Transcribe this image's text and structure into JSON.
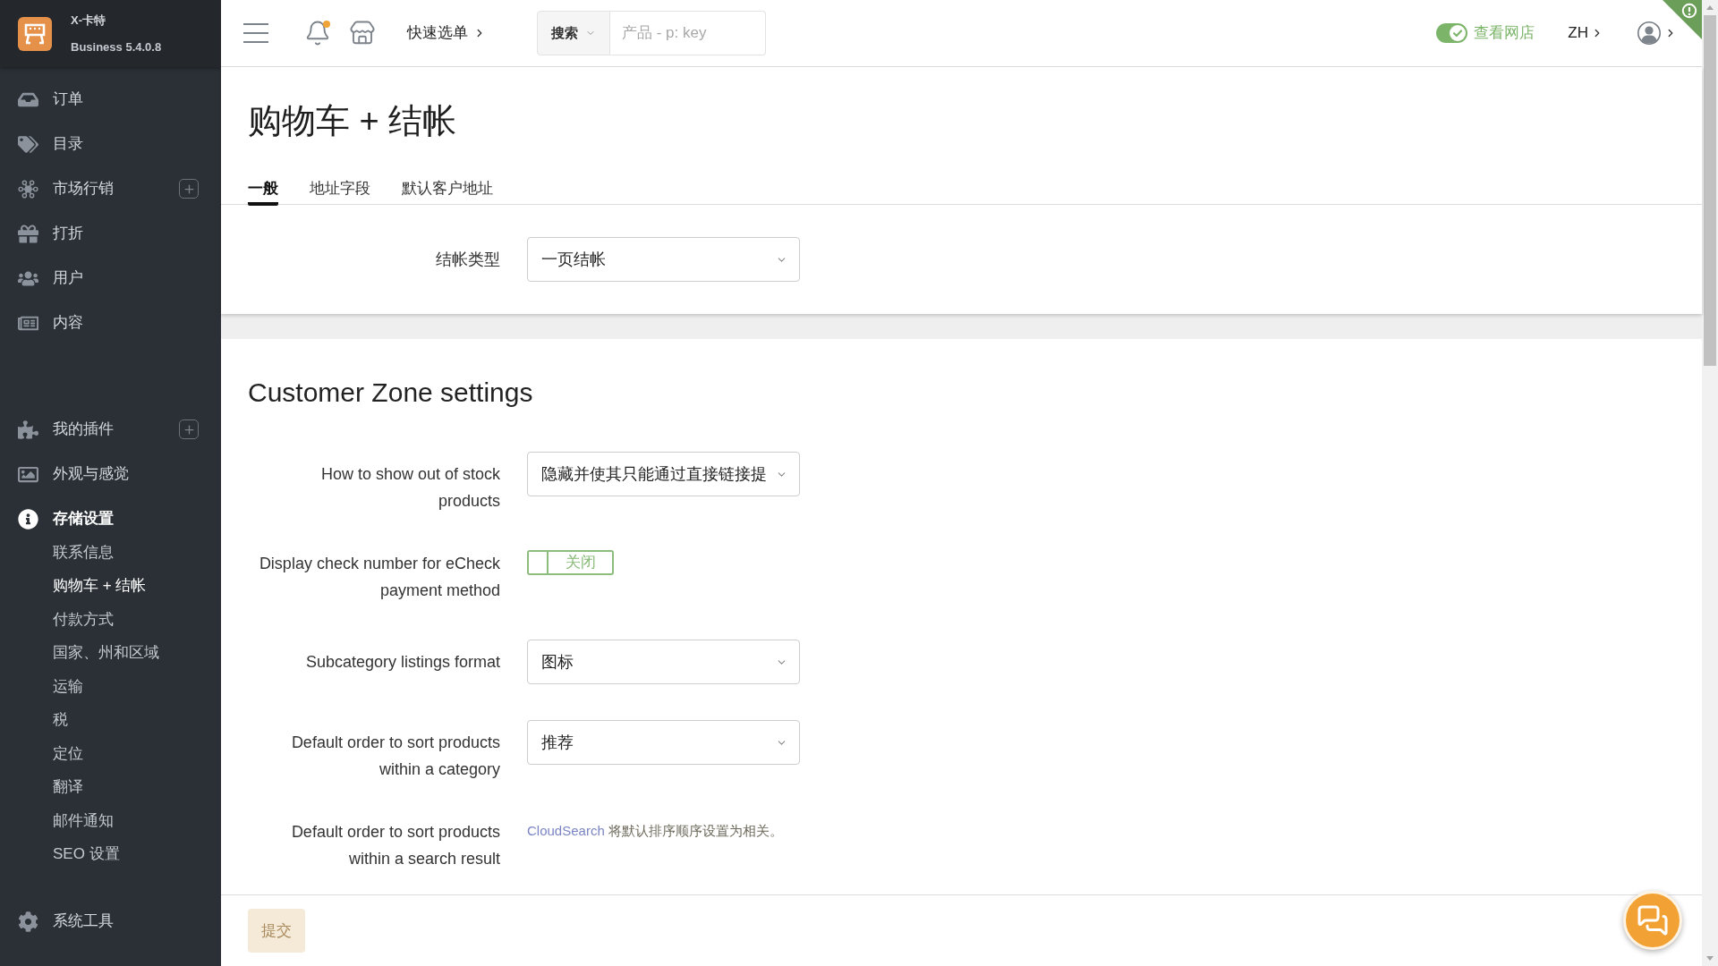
{
  "sidebar": {
    "brand": {
      "name": "X-卡特",
      "version": "Business 5.4.0.8"
    },
    "groups": [
      [
        {
          "label": "订单",
          "expanded": false,
          "add_button": false
        },
        {
          "label": "目录",
          "expanded": false,
          "add_button": false
        },
        {
          "label": "市场行销",
          "expanded": false,
          "add_button": true
        },
        {
          "label": "打折",
          "expanded": false,
          "add_button": false
        },
        {
          "label": "用户",
          "expanded": false,
          "add_button": false
        },
        {
          "label": "内容",
          "expanded": false,
          "add_button": false
        }
      ],
      [
        {
          "label": "我的插件",
          "expanded": false,
          "add_button": true
        },
        {
          "label": "外观与感觉",
          "expanded": false,
          "add_button": false
        },
        {
          "label": "存储设置",
          "expanded": true,
          "add_button": false,
          "children": [
            {
              "label": "联系信息",
              "selected": false
            },
            {
              "label": "购物车 + 结帐",
              "selected": true
            },
            {
              "label": "付款方式",
              "selected": false
            },
            {
              "label": "国家、州和区域",
              "selected": false
            },
            {
              "label": "运输",
              "selected": false
            },
            {
              "label": "税",
              "selected": false
            },
            {
              "label": "定位",
              "selected": false
            },
            {
              "label": "翻译",
              "selected": false
            },
            {
              "label": "邮件通知",
              "selected": false
            },
            {
              "label": "SEO 设置",
              "selected": false
            }
          ]
        }
      ],
      [
        {
          "label": "系统工具",
          "expanded": false,
          "add_button": false
        }
      ]
    ]
  },
  "header": {
    "notifications": {
      "unread": true
    },
    "quick_menu": "快速选单",
    "search": {
      "scope": "搜索",
      "placeholder": "产品 - p: key"
    },
    "storefront": {
      "label": "查看网店",
      "on": true
    },
    "language": "ZH"
  },
  "page": {
    "title": "购物车 + 结帐",
    "tabs": [
      {
        "label": "一般",
        "selected": true
      },
      {
        "label": "地址字段",
        "selected": false
      },
      {
        "label": "默认客户地址",
        "selected": false
      }
    ],
    "general": {
      "fields": [
        {
          "kind": "select",
          "label": "结帐类型",
          "value": "一页结帐"
        }
      ]
    },
    "customer_zone": {
      "title": "Customer Zone settings",
      "fields": [
        {
          "kind": "select",
          "label": "How to show out of stock products",
          "value": "隐藏并使其只能通过直接链接提"
        },
        {
          "kind": "toggle",
          "label": "Display check number for eCheck payment method",
          "on": false,
          "state_text": "关闭"
        },
        {
          "kind": "select",
          "label": "Subcategory listings format",
          "value": "图标"
        },
        {
          "kind": "select",
          "label": "Default order to sort products within a category",
          "value": "推荐"
        },
        {
          "kind": "note",
          "label": "Default order to sort products within a search result",
          "link": "CloudSearch",
          "text": "将默认排序顺序设置为相关。"
        }
      ]
    },
    "submit": {
      "label": "提交",
      "disabled": true
    }
  }
}
